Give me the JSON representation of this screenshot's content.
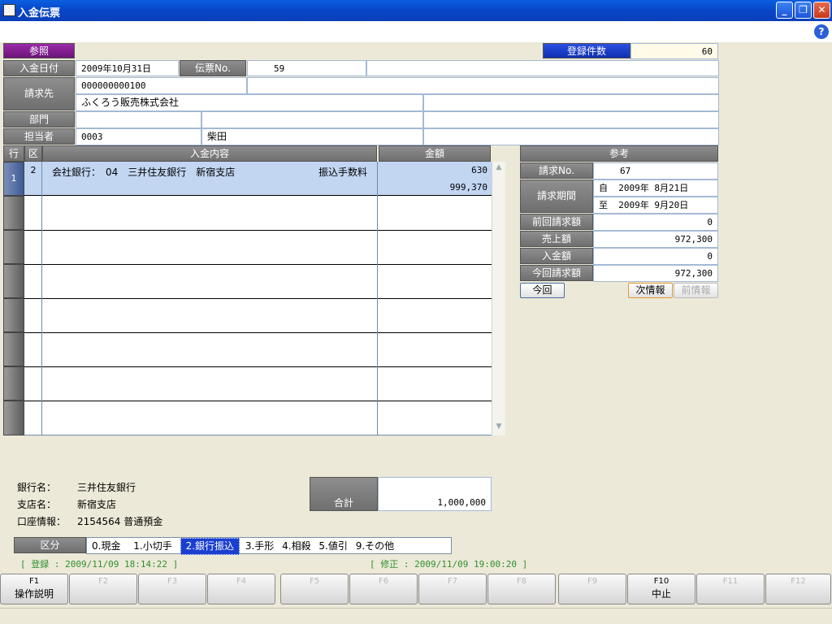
{
  "window": {
    "title": "入金伝票",
    "min": "_",
    "max": "❐",
    "close": "✕"
  },
  "help": "?",
  "top": {
    "ref_label": "参照",
    "count_label": "登録件数",
    "count": "60"
  },
  "form": {
    "date_label": "入金日付",
    "date": "2009年10月31日",
    "slip_label": "伝票No.",
    "slip_no": "59",
    "bill_label": "請求先",
    "bill_code": "000000000100",
    "bill_name": "ふくろう販売株式会社",
    "dept_label": "部門",
    "staff_label": "担当者",
    "staff_code": "0003",
    "staff_name": "柴田"
  },
  "table": {
    "col_row": "行",
    "col_kind": "区",
    "col_content": "入金内容",
    "col_amount": "金額",
    "row1": {
      "no": "1",
      "kind": "2",
      "content": "会社銀行：　04　三井住友銀行　新宿支店",
      "fee_label": "振込手数料",
      "amount1": "630",
      "amount2": "999,370"
    }
  },
  "ref": {
    "title": "参考",
    "invoice_label": "請求No.",
    "invoice_no": "67",
    "period_label": "請求期間",
    "from_prefix": "自",
    "from": "2009年 8月21日",
    "to_prefix": "至",
    "to": "2009年 9月20日",
    "prev_label": "前回請求額",
    "prev": "0",
    "sales_label": "売上額",
    "sales": "972,300",
    "paid_label": "入金額",
    "paid": "0",
    "current_label": "今回請求額",
    "current": "972,300",
    "btn_now": "今回",
    "btn_next": "次情報",
    "btn_prev": "前情報"
  },
  "bank": {
    "name_label": "銀行名：",
    "name": "三井住友銀行",
    "branch_label": "支店名：",
    "branch": "新宿支店",
    "account_label": "口座情報：",
    "account": "2154564 普通預金"
  },
  "total": {
    "label": "合計",
    "value": "1,000,000"
  },
  "kubun": {
    "label": "区分",
    "items": [
      "0.現金",
      "1.小切手",
      "2.銀行振込",
      "3.手形",
      "4.相殺",
      "5.値引",
      "9.その他"
    ],
    "selected": "2.銀行振込"
  },
  "status": {
    "created": "[ 登録 :  2009/11/09 18:14:22 ]",
    "modified": "[ 修正 :  2009/11/09 19:00:20 ]"
  },
  "fkeys": [
    {
      "key": "F1",
      "label": "操作説明"
    },
    {
      "key": "F2",
      "label": ""
    },
    {
      "key": "F3",
      "label": ""
    },
    {
      "key": "F4",
      "label": ""
    },
    {
      "key": "F5",
      "label": ""
    },
    {
      "key": "F6",
      "label": ""
    },
    {
      "key": "F7",
      "label": ""
    },
    {
      "key": "F8",
      "label": ""
    },
    {
      "key": "F9",
      "label": ""
    },
    {
      "key": "F10",
      "label": "中止"
    },
    {
      "key": "F11",
      "label": ""
    },
    {
      "key": "F12",
      "label": ""
    }
  ],
  "colors": {
    "title_blue": "#0846c8",
    "selected_row": "#c2d6f2",
    "count_header": "#1a3fc8",
    "purple": "#7a1f8c"
  }
}
